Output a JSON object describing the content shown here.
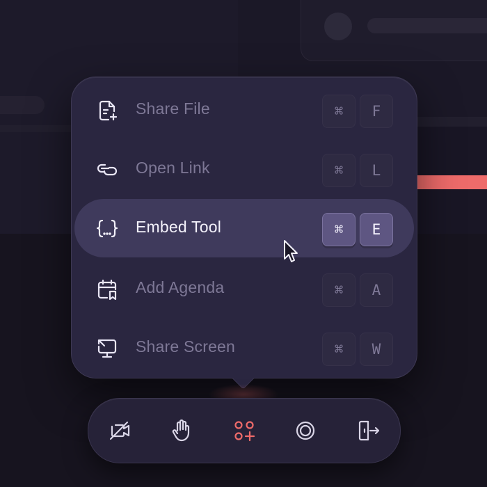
{
  "menu": {
    "items": [
      {
        "label": "Share File",
        "keys": [
          "⌘",
          "F"
        ],
        "icon": "file-plus-icon",
        "active": false
      },
      {
        "label": "Open Link",
        "keys": [
          "⌘",
          "L"
        ],
        "icon": "link-icon",
        "active": false
      },
      {
        "label": "Embed Tool",
        "keys": [
          "⌘",
          "E"
        ],
        "icon": "code-braces-icon",
        "active": true
      },
      {
        "label": "Add Agenda",
        "keys": [
          "⌘",
          "A"
        ],
        "icon": "calendar-bookmark-icon",
        "active": false
      },
      {
        "label": "Share Screen",
        "keys": [
          "⌘",
          "W"
        ],
        "icon": "screen-share-icon",
        "active": false
      }
    ]
  },
  "toolbar": {
    "buttons": [
      {
        "icon": "video-off-icon",
        "active": false
      },
      {
        "icon": "raise-hand-icon",
        "active": false
      },
      {
        "icon": "apps-add-icon",
        "active": true
      },
      {
        "icon": "record-icon",
        "active": false
      },
      {
        "icon": "leave-icon",
        "active": false
      }
    ]
  },
  "colors": {
    "accent": "#ee6b6a",
    "panel": "#2a2640",
    "active_row": "#3f3a5c",
    "background": "#191625"
  }
}
